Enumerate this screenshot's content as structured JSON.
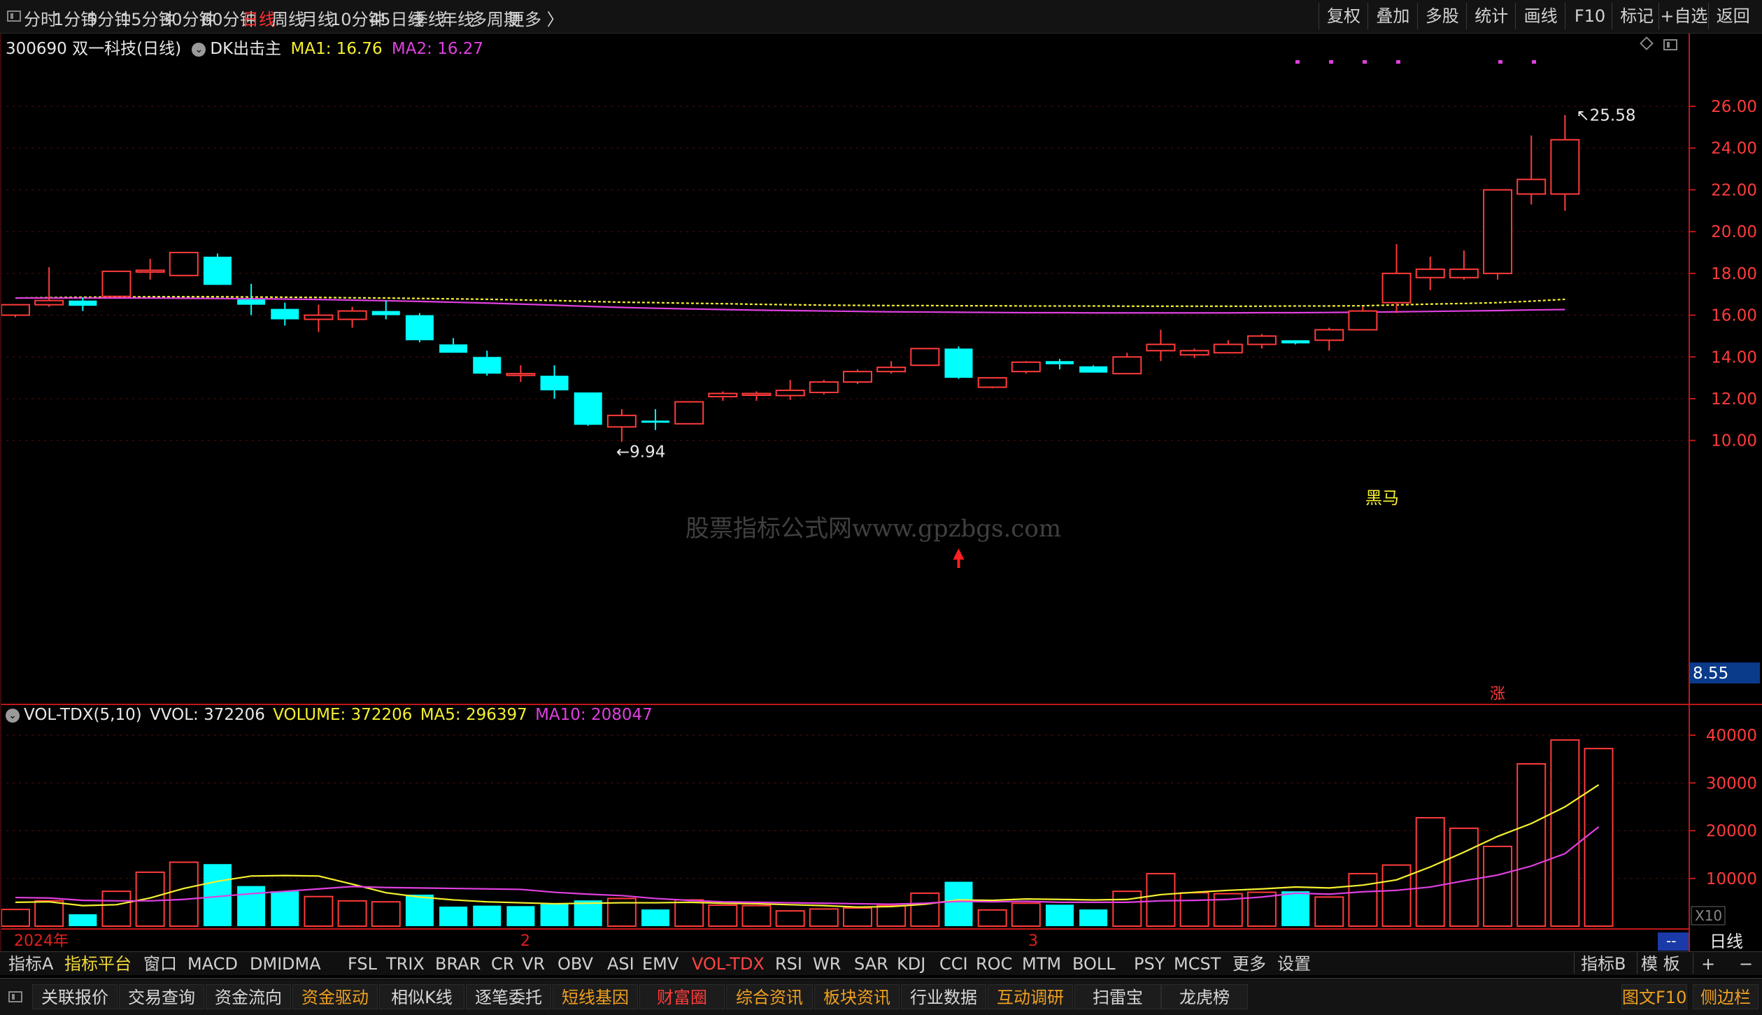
{
  "periods": [
    {
      "label": "分时",
      "active": false
    },
    {
      "label": "1分钟",
      "active": false
    },
    {
      "label": "5分钟",
      "active": false
    },
    {
      "label": "15分钟",
      "active": false
    },
    {
      "label": "30分钟",
      "active": false
    },
    {
      "label": "60分钟",
      "active": false
    },
    {
      "label": "日线",
      "active": true
    },
    {
      "label": "周线",
      "active": false
    },
    {
      "label": "月线",
      "active": false
    },
    {
      "label": "10分钟",
      "active": false
    },
    {
      "label": "45日线",
      "active": false
    },
    {
      "label": "季线",
      "active": false
    },
    {
      "label": "年线",
      "active": false
    },
    {
      "label": "多周期",
      "active": false
    },
    {
      "label": "更多 〉",
      "active": false
    }
  ],
  "toolbar": [
    "复权",
    "叠加",
    "多股",
    "统计",
    "画线",
    "F10",
    "标记",
    "+自选",
    "返回"
  ],
  "header": {
    "stock": "300690 双一科技(日线)",
    "indicator": "DK出击主",
    "ma1": "MA1: 16.76",
    "ma2": "MA2: 16.27"
  },
  "price_axis": {
    "ticks": [
      "26.00",
      "24.00",
      "22.00",
      "20.00",
      "18.00",
      "16.00",
      "14.00",
      "12.00",
      "10.00"
    ],
    "current": "8.55"
  },
  "annotations": {
    "high": "25.58",
    "low": "9.94",
    "black_horse": "黑马",
    "zhang": "涨",
    "watermark": "股票指标公式网www.gpzbgs.com"
  },
  "volume_header": {
    "name": "VOL-TDX(5,10)",
    "vvol": "VVOL: 372206",
    "volume": "VOLUME: 372206",
    "ma5": "MA5: 296397",
    "ma10": "MA10: 208047"
  },
  "volume_axis": {
    "ticks": [
      "40000",
      "30000",
      "20000",
      "10000"
    ],
    "unit": "X10"
  },
  "date_axis": {
    "labels": [
      "2024年",
      "2",
      "3"
    ],
    "dash": "--",
    "period_label": "日线"
  },
  "indicator_tabs": [
    {
      "label": "指标A",
      "style": "normal"
    },
    {
      "label": "指标平台",
      "style": "yellow"
    },
    {
      "label": "窗口",
      "style": "normal"
    },
    {
      "label": "MACD",
      "style": "normal"
    },
    {
      "label": "DMI",
      "style": "normal"
    },
    {
      "label": "DMA",
      "style": "normal"
    },
    {
      "label": "FSL",
      "style": "normal"
    },
    {
      "label": "TRIX",
      "style": "normal"
    },
    {
      "label": "BRAR",
      "style": "normal"
    },
    {
      "label": "CR",
      "style": "normal"
    },
    {
      "label": "VR",
      "style": "normal"
    },
    {
      "label": "OBV",
      "style": "normal"
    },
    {
      "label": "ASI",
      "style": "normal"
    },
    {
      "label": "EMV",
      "style": "normal"
    },
    {
      "label": "VOL-TDX",
      "style": "active"
    },
    {
      "label": "RSI",
      "style": "normal"
    },
    {
      "label": "WR",
      "style": "normal"
    },
    {
      "label": "SAR",
      "style": "normal"
    },
    {
      "label": "KDJ",
      "style": "normal"
    },
    {
      "label": "CCI",
      "style": "normal"
    },
    {
      "label": "ROC",
      "style": "normal"
    },
    {
      "label": "MTM",
      "style": "normal"
    },
    {
      "label": "BOLL",
      "style": "normal"
    },
    {
      "label": "PSY",
      "style": "normal"
    },
    {
      "label": "MCST",
      "style": "normal"
    },
    {
      "label": "更多",
      "style": "normal"
    },
    {
      "label": "设置",
      "style": "normal"
    }
  ],
  "indicator_right": [
    "指标B",
    "模 板",
    "+",
    "−"
  ],
  "bottom_tabs": [
    {
      "label": "关联报价",
      "style": "normal"
    },
    {
      "label": "交易查询",
      "style": "normal"
    },
    {
      "label": "资金流向",
      "style": "normal"
    },
    {
      "label": "资金驱动",
      "style": "orange"
    },
    {
      "label": "相似K线",
      "style": "normal"
    },
    {
      "label": "逐笔委托",
      "style": "normal"
    },
    {
      "label": "短线基因",
      "style": "orange"
    },
    {
      "label": "财富圈",
      "style": "red"
    },
    {
      "label": "综合资讯",
      "style": "orange"
    },
    {
      "label": "板块资讯",
      "style": "orange"
    },
    {
      "label": "行业数据",
      "style": "normal"
    },
    {
      "label": "互动调研",
      "style": "orange"
    },
    {
      "label": "扫雷宝",
      "style": "normal"
    },
    {
      "label": "龙虎榜",
      "style": "normal"
    }
  ],
  "bottom_right": [
    "图文F10",
    "侧边栏"
  ],
  "colors": {
    "up": "#ff3b3b",
    "down": "#00ffff",
    "ma1": "#f5f030",
    "ma2": "#e040e0",
    "axis": "#c01818"
  },
  "chart_data": {
    "type": "candlestick",
    "price_ylim": [
      8.55,
      26.6
    ],
    "candles": [
      {
        "o": 16.0,
        "h": 16.4,
        "l": 15.9,
        "c": 16.5
      },
      {
        "o": 16.5,
        "h": 18.3,
        "l": 16.4,
        "c": 16.7
      },
      {
        "o": 16.7,
        "h": 16.85,
        "l": 16.2,
        "c": 16.45
      },
      {
        "o": 16.9,
        "h": 18.0,
        "l": 16.85,
        "c": 18.1
      },
      {
        "o": 18.1,
        "h": 18.7,
        "l": 17.7,
        "c": 18.15
      },
      {
        "o": 17.9,
        "h": 18.9,
        "l": 17.9,
        "c": 19.0
      },
      {
        "o": 18.8,
        "h": 18.95,
        "l": 17.5,
        "c": 17.45
      },
      {
        "o": 16.75,
        "h": 17.5,
        "l": 16.0,
        "c": 16.5
      },
      {
        "o": 16.3,
        "h": 16.6,
        "l": 15.5,
        "c": 15.8
      },
      {
        "o": 15.8,
        "h": 16.5,
        "l": 15.2,
        "c": 16.0
      },
      {
        "o": 15.8,
        "h": 16.4,
        "l": 15.4,
        "c": 16.2
      },
      {
        "o": 16.2,
        "h": 16.7,
        "l": 15.8,
        "c": 16.0
      },
      {
        "o": 16.0,
        "h": 16.1,
        "l": 14.7,
        "c": 14.8
      },
      {
        "o": 14.6,
        "h": 14.9,
        "l": 14.2,
        "c": 14.2
      },
      {
        "o": 14.0,
        "h": 14.3,
        "l": 13.1,
        "c": 13.2
      },
      {
        "o": 13.2,
        "h": 13.6,
        "l": 12.8,
        "c": 13.2
      },
      {
        "o": 13.1,
        "h": 13.6,
        "l": 12.0,
        "c": 12.4
      },
      {
        "o": 12.3,
        "h": 12.3,
        "l": 10.7,
        "c": 10.75
      },
      {
        "o": 10.65,
        "h": 11.5,
        "l": 9.94,
        "c": 11.2
      },
      {
        "o": 10.95,
        "h": 11.5,
        "l": 10.5,
        "c": 10.85
      },
      {
        "o": 10.8,
        "h": 11.8,
        "l": 10.8,
        "c": 11.85
      },
      {
        "o": 12.1,
        "h": 12.35,
        "l": 11.9,
        "c": 12.25
      },
      {
        "o": 12.2,
        "h": 12.35,
        "l": 11.9,
        "c": 12.25
      },
      {
        "o": 12.15,
        "h": 12.9,
        "l": 11.95,
        "c": 12.4
      },
      {
        "o": 12.3,
        "h": 12.9,
        "l": 12.2,
        "c": 12.8
      },
      {
        "o": 12.8,
        "h": 13.4,
        "l": 12.7,
        "c": 13.3
      },
      {
        "o": 13.3,
        "h": 13.8,
        "l": 13.2,
        "c": 13.5
      },
      {
        "o": 13.6,
        "h": 14.4,
        "l": 13.6,
        "c": 14.4
      },
      {
        "o": 14.4,
        "h": 14.5,
        "l": 12.95,
        "c": 13.0
      },
      {
        "o": 12.55,
        "h": 13.0,
        "l": 12.5,
        "c": 13.0
      },
      {
        "o": 13.3,
        "h": 13.8,
        "l": 13.2,
        "c": 13.75
      },
      {
        "o": 13.8,
        "h": 13.9,
        "l": 13.4,
        "c": 13.65
      },
      {
        "o": 13.55,
        "h": 13.6,
        "l": 13.3,
        "c": 13.25
      },
      {
        "o": 13.2,
        "h": 14.2,
        "l": 13.2,
        "c": 14.0
      },
      {
        "o": 14.3,
        "h": 15.3,
        "l": 13.8,
        "c": 14.6
      },
      {
        "o": 14.1,
        "h": 14.4,
        "l": 13.95,
        "c": 14.3
      },
      {
        "o": 14.2,
        "h": 14.8,
        "l": 14.2,
        "c": 14.6
      },
      {
        "o": 14.6,
        "h": 15.1,
        "l": 14.4,
        "c": 15.0
      },
      {
        "o": 14.8,
        "h": 14.8,
        "l": 14.6,
        "c": 14.65
      },
      {
        "o": 14.8,
        "h": 15.4,
        "l": 14.3,
        "c": 15.3
      },
      {
        "o": 15.3,
        "h": 16.4,
        "l": 15.3,
        "c": 16.2
      },
      {
        "o": 16.6,
        "h": 19.4,
        "l": 16.1,
        "c": 18.0
      },
      {
        "o": 17.8,
        "h": 18.8,
        "l": 17.2,
        "c": 18.2
      },
      {
        "o": 17.8,
        "h": 19.1,
        "l": 17.7,
        "c": 18.2
      },
      {
        "o": 18.0,
        "h": 18.0,
        "l": 17.7,
        "c": 22.0
      },
      {
        "o": 21.8,
        "h": 24.6,
        "l": 21.3,
        "c": 22.5
      },
      {
        "o": 21.8,
        "h": 25.58,
        "l": 21.0,
        "c": 24.4
      }
    ],
    "ma1_line": [
      16.82,
      16.84,
      16.86,
      16.87,
      16.88,
      16.88,
      16.88,
      16.87,
      16.86,
      16.85,
      16.83,
      16.82,
      16.8,
      16.78,
      16.76,
      16.73,
      16.7,
      16.66,
      16.62,
      16.6,
      16.57,
      16.55,
      16.52,
      16.5,
      16.48,
      16.47,
      16.46,
      16.46,
      16.45,
      16.45,
      16.44,
      16.44,
      16.44,
      16.43,
      16.43,
      16.43,
      16.43,
      16.43,
      16.44,
      16.44,
      16.45,
      16.49,
      16.53,
      16.56,
      16.6,
      16.67,
      16.76
    ],
    "ma2_line": [
      16.82,
      16.82,
      16.82,
      16.82,
      16.82,
      16.81,
      16.8,
      16.79,
      16.77,
      16.75,
      16.72,
      16.69,
      16.66,
      16.62,
      16.58,
      16.53,
      16.48,
      16.42,
      16.37,
      16.33,
      16.3,
      16.27,
      16.24,
      16.22,
      16.2,
      16.18,
      16.16,
      16.15,
      16.14,
      16.13,
      16.12,
      16.12,
      16.11,
      16.11,
      16.11,
      16.11,
      16.11,
      16.12,
      16.12,
      16.13,
      16.14,
      16.16,
      16.18,
      16.2,
      16.22,
      16.25,
      16.27
    ],
    "volume_ylim": [
      0,
      44000
    ],
    "volumes": [
      3500,
      5300,
      2500,
      7300,
      11300,
      13400,
      13000,
      8400,
      7300,
      6200,
      5300,
      5100,
      6600,
      4100,
      4300,
      4200,
      4600,
      5400,
      5800,
      3500,
      5500,
      4400,
      4300,
      3200,
      3600,
      3800,
      4300,
      6900,
      9300,
      3400,
      4800,
      4500,
      3500,
      7300,
      11000,
      7000,
      6800,
      7100,
      7300,
      6100,
      11000,
      12800,
      22700,
      20500,
      16700,
      34000,
      39000,
      37200
    ],
    "vol_up": [
      true,
      true,
      false,
      true,
      true,
      true,
      false,
      false,
      false,
      true,
      true,
      true,
      false,
      false,
      false,
      false,
      false,
      false,
      true,
      false,
      true,
      true,
      true,
      true,
      true,
      true,
      true,
      true,
      false,
      true,
      true,
      false,
      false,
      true,
      true,
      true,
      true,
      true,
      false,
      true,
      true,
      true,
      true,
      true,
      true,
      true,
      true,
      true
    ],
    "vol_ma5": [
      5000,
      5100,
      4300,
      4500,
      5900,
      7900,
      9400,
      10500,
      10600,
      10500,
      8800,
      7000,
      6100,
      5500,
      5100,
      4900,
      4700,
      4800,
      4900,
      4900,
      5000,
      4800,
      4700,
      4500,
      4300,
      4000,
      4100,
      4600,
      5500,
      5400,
      5700,
      5600,
      5500,
      5600,
      6600,
      7100,
      7500,
      7800,
      8200,
      8000,
      8600,
      9700,
      12400,
      15500,
      18800,
      21500,
      25000,
      29600
    ],
    "vol_ma10": [
      6000,
      5900,
      5400,
      5300,
      5300,
      5600,
      6200,
      6800,
      7300,
      7800,
      8300,
      8100,
      8000,
      7900,
      7800,
      7700,
      7100,
      6700,
      6400,
      5800,
      5400,
      5100,
      5000,
      4900,
      4800,
      4700,
      4600,
      4800,
      5200,
      5100,
      5200,
      5000,
      5000,
      5000,
      5300,
      5400,
      5600,
      6100,
      6900,
      6700,
      7200,
      7500,
      8200,
      9500,
      10700,
      12600,
      15200,
      20800
    ]
  }
}
